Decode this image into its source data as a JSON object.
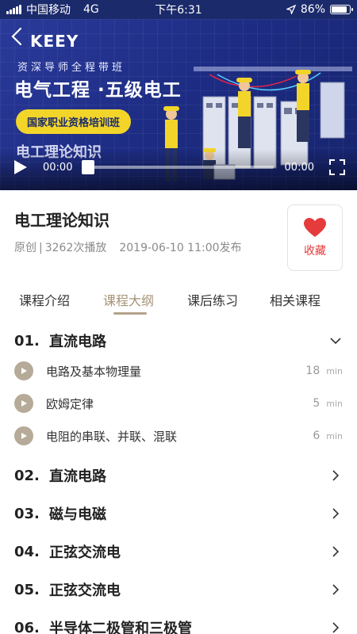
{
  "status_bar": {
    "carrier": "中国移动",
    "network": "4G",
    "time": "下午6:31",
    "battery": "86%",
    "battery_level": 0.86
  },
  "video": {
    "logo": "KEEY",
    "subtitle": "资深导师全程带班",
    "title": "电气工程 ·五级电工",
    "badge": "国家职业资格培训班",
    "caption": "电工理论知识",
    "current_time": "00:00",
    "total_time": "00:00",
    "progress": 0
  },
  "course": {
    "title": "电工理论知识",
    "type": "原创",
    "separator": "|",
    "plays": "3262次播放",
    "published": "2019-06-10 11:00发布",
    "favorite_label": "收藏"
  },
  "tabs": [
    {
      "label": "课程介绍",
      "active": false
    },
    {
      "label": "课程大纲",
      "active": true
    },
    {
      "label": "课后练习",
      "active": false
    },
    {
      "label": "相关课程",
      "active": false
    }
  ],
  "outline": {
    "chapters": [
      {
        "number": "01.",
        "title": "直流电路",
        "expanded": true,
        "lessons": [
          {
            "title": "电路及基本物理量",
            "duration": "18",
            "unit": "min"
          },
          {
            "title": "欧姆定律",
            "duration": "5",
            "unit": "min"
          },
          {
            "title": "电阻的串联、并联、混联",
            "duration": "6",
            "unit": "min"
          }
        ]
      },
      {
        "number": "02.",
        "title": "直流电路",
        "expanded": false
      },
      {
        "number": "03.",
        "title": "磁与电磁",
        "expanded": false
      },
      {
        "number": "04.",
        "title": "正弦交流电",
        "expanded": false
      },
      {
        "number": "05.",
        "title": "正弦交流电",
        "expanded": false
      },
      {
        "number": "06.",
        "title": "半导体二极管和三极管",
        "expanded": false
      }
    ]
  },
  "colors": {
    "banner": "#1e2d85",
    "badge": "#f3d52a",
    "accent_tab": "#a69377",
    "favorite": "#e53b3b",
    "lesson_play": "#b6aa98"
  }
}
